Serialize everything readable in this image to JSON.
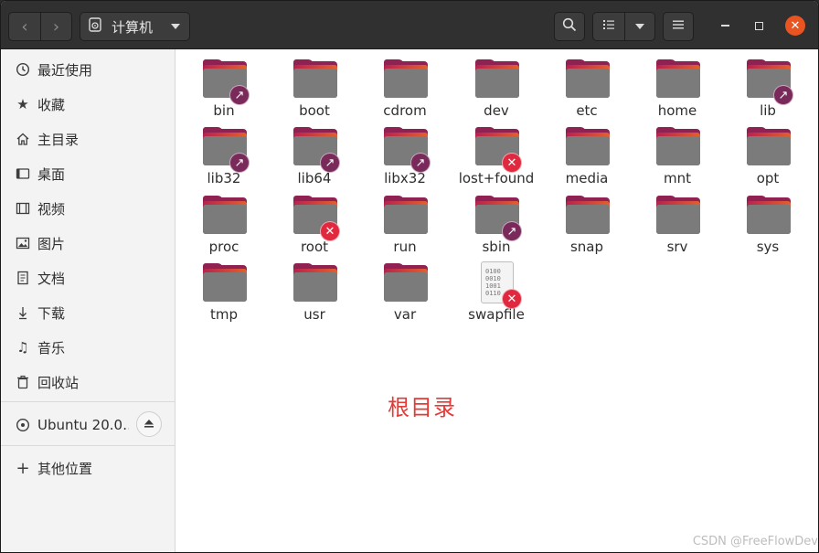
{
  "header": {
    "path_label": "计算机"
  },
  "sidebar": {
    "items": [
      {
        "label": "最近使用",
        "icon": "clock-icon"
      },
      {
        "label": "收藏",
        "icon": "star-icon"
      },
      {
        "label": "主目录",
        "icon": "home-icon"
      },
      {
        "label": "桌面",
        "icon": "desktop-icon"
      },
      {
        "label": "视频",
        "icon": "video-icon"
      },
      {
        "label": "图片",
        "icon": "picture-icon"
      },
      {
        "label": "文档",
        "icon": "document-icon"
      },
      {
        "label": "下载",
        "icon": "download-icon"
      },
      {
        "label": "音乐",
        "icon": "music-icon"
      },
      {
        "label": "回收站",
        "icon": "trash-icon"
      }
    ],
    "device": {
      "label": "Ubuntu 20.0…",
      "icon": "disc-icon"
    },
    "other": {
      "label": "其他位置",
      "icon": "plus-icon"
    }
  },
  "files": [
    {
      "name": "bin",
      "type": "folder",
      "emblem": "link"
    },
    {
      "name": "boot",
      "type": "folder",
      "emblem": ""
    },
    {
      "name": "cdrom",
      "type": "folder",
      "emblem": ""
    },
    {
      "name": "dev",
      "type": "folder",
      "emblem": ""
    },
    {
      "name": "etc",
      "type": "folder",
      "emblem": ""
    },
    {
      "name": "home",
      "type": "folder",
      "emblem": ""
    },
    {
      "name": "lib",
      "type": "folder",
      "emblem": "link"
    },
    {
      "name": "lib32",
      "type": "folder",
      "emblem": "link"
    },
    {
      "name": "lib64",
      "type": "folder",
      "emblem": "link"
    },
    {
      "name": "libx32",
      "type": "folder",
      "emblem": "link"
    },
    {
      "name": "lost+found",
      "type": "folder",
      "emblem": "locked"
    },
    {
      "name": "media",
      "type": "folder",
      "emblem": ""
    },
    {
      "name": "mnt",
      "type": "folder",
      "emblem": ""
    },
    {
      "name": "opt",
      "type": "folder",
      "emblem": ""
    },
    {
      "name": "proc",
      "type": "folder",
      "emblem": ""
    },
    {
      "name": "root",
      "type": "folder",
      "emblem": "locked"
    },
    {
      "name": "run",
      "type": "folder",
      "emblem": ""
    },
    {
      "name": "sbin",
      "type": "folder",
      "emblem": "link"
    },
    {
      "name": "snap",
      "type": "folder",
      "emblem": ""
    },
    {
      "name": "srv",
      "type": "folder",
      "emblem": ""
    },
    {
      "name": "sys",
      "type": "folder",
      "emblem": ""
    },
    {
      "name": "tmp",
      "type": "folder",
      "emblem": ""
    },
    {
      "name": "usr",
      "type": "folder",
      "emblem": ""
    },
    {
      "name": "var",
      "type": "folder",
      "emblem": ""
    },
    {
      "name": "swapfile",
      "type": "binary",
      "emblem": "locked"
    }
  ],
  "annotation": "根目录",
  "watermark": "CSDN @FreeFlowDev",
  "colors": {
    "accent": "#e95420",
    "folder_top": "#8f2252",
    "annotation": "#e53935"
  }
}
